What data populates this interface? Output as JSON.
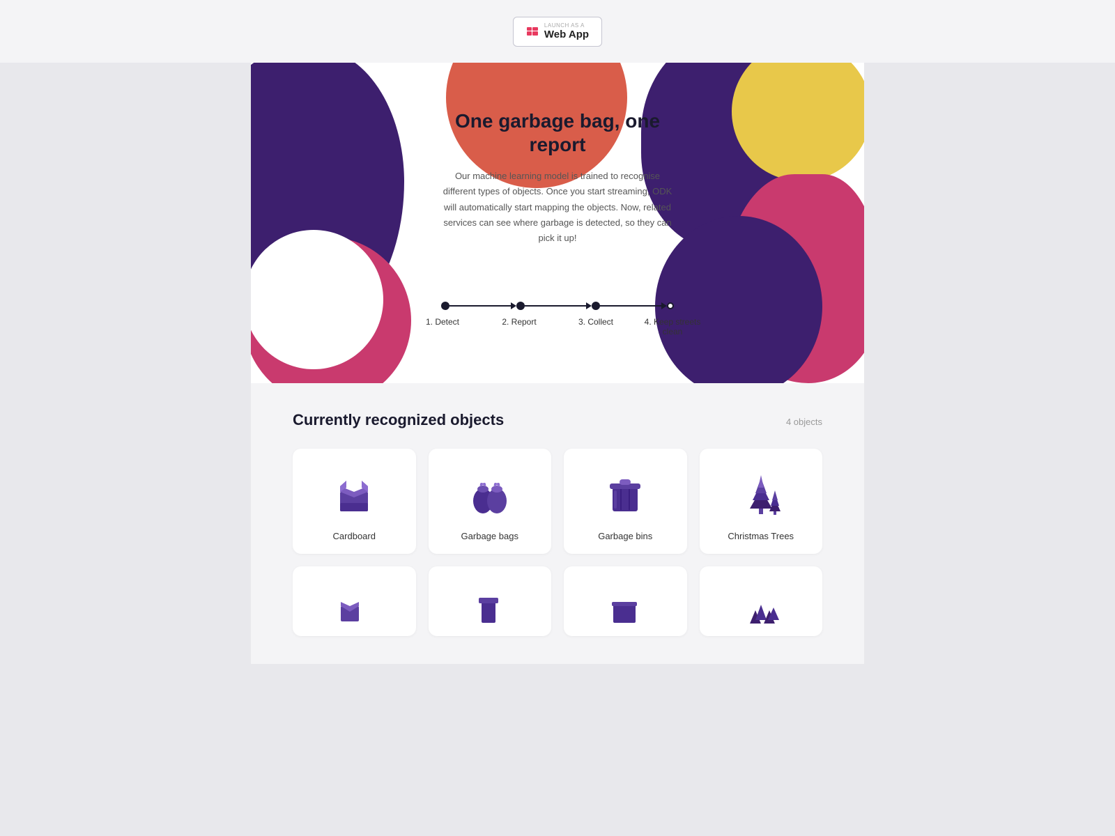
{
  "topbar": {
    "pwa_label": "LAUNCH AS A",
    "web_app_label": "Web App"
  },
  "hero": {
    "title": "One garbage bag, one report",
    "description": "Our machine learning model is trained to recognise different types of objects. Once you start streaming, ODK will automatically start mapping the objects. Now, related services can see where garbage is detected, so they can pick it up!",
    "steps": [
      {
        "number": "1",
        "label": "1. Detect"
      },
      {
        "number": "2",
        "label": "2. Report"
      },
      {
        "number": "3",
        "label": "3. Collect"
      },
      {
        "number": "4",
        "label": "4. Keep streets clean"
      }
    ]
  },
  "objects_section": {
    "title": "Currently recognized objects",
    "count": "4 objects",
    "items": [
      {
        "id": "cardboard",
        "label": "Cardboard"
      },
      {
        "id": "garbage-bags",
        "label": "Garbage bags"
      },
      {
        "id": "garbage-bins",
        "label": "Garbage bins"
      },
      {
        "id": "christmas-trees",
        "label": "Christmas Trees"
      }
    ]
  },
  "colors": {
    "purple_dark": "#3d1f6e",
    "red": "#d95d4a",
    "pink": "#c93a6e",
    "yellow": "#e8c84a",
    "accent": "#5b3fa0"
  }
}
